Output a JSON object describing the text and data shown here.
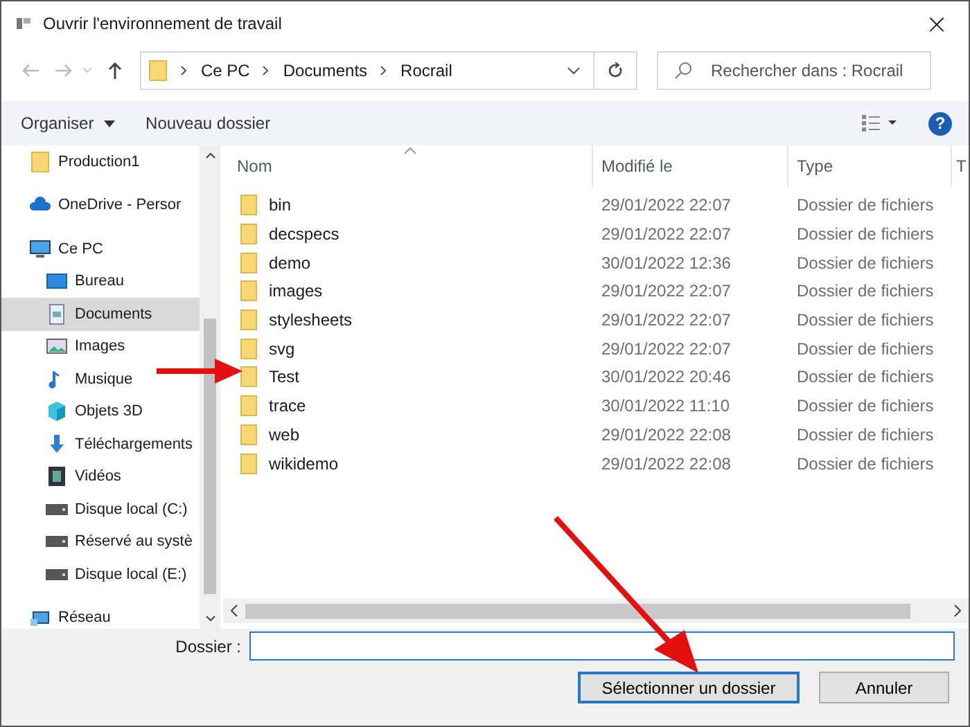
{
  "window": {
    "title": "Ouvrir l'environnement de travail",
    "close": "×"
  },
  "breadcrumb": [
    "Ce PC",
    "Documents",
    "Rocrail"
  ],
  "search": {
    "placeholder": "Rechercher dans : Rocrail"
  },
  "toolbar": {
    "organize": "Organiser",
    "new_folder": "Nouveau dossier",
    "help": "?"
  },
  "sidebar": {
    "items": [
      {
        "label": "Production1",
        "kind": "folder",
        "selected": false
      },
      {
        "label": "OneDrive - Persor",
        "kind": "cloud",
        "selected": false
      },
      {
        "label": "Ce PC",
        "kind": "pc",
        "selected": false,
        "children": [
          {
            "label": "Bureau",
            "kind": "desktop",
            "selected": false
          },
          {
            "label": "Documents",
            "kind": "documents",
            "selected": true
          },
          {
            "label": "Images",
            "kind": "images",
            "selected": false
          },
          {
            "label": "Musique",
            "kind": "music",
            "selected": false
          },
          {
            "label": "Objets 3D",
            "kind": "cube",
            "selected": false
          },
          {
            "label": "Téléchargements",
            "kind": "download",
            "selected": false
          },
          {
            "label": "Vidéos",
            "kind": "video",
            "selected": false
          },
          {
            "label": "Disque local (C:)",
            "kind": "drive",
            "selected": false
          },
          {
            "label": "Réservé au systè",
            "kind": "drive",
            "selected": false
          },
          {
            "label": "Disque local (E:)",
            "kind": "drive",
            "selected": false
          }
        ]
      },
      {
        "label": "Réseau",
        "kind": "network",
        "selected": false
      }
    ]
  },
  "table": {
    "columns": [
      "Nom",
      "Modifié le",
      "Type",
      "T"
    ],
    "rows": [
      {
        "name": "bin",
        "modified": "29/01/2022 22:07",
        "type": "Dossier de fichiers"
      },
      {
        "name": "decspecs",
        "modified": "29/01/2022 22:07",
        "type": "Dossier de fichiers"
      },
      {
        "name": "demo",
        "modified": "30/01/2022 12:36",
        "type": "Dossier de fichiers"
      },
      {
        "name": "images",
        "modified": "29/01/2022 22:07",
        "type": "Dossier de fichiers"
      },
      {
        "name": "stylesheets",
        "modified": "29/01/2022 22:07",
        "type": "Dossier de fichiers"
      },
      {
        "name": "svg",
        "modified": "29/01/2022 22:07",
        "type": "Dossier de fichiers"
      },
      {
        "name": "Test",
        "modified": "30/01/2022 20:46",
        "type": "Dossier de fichiers"
      },
      {
        "name": "trace",
        "modified": "30/01/2022 11:10",
        "type": "Dossier de fichiers"
      },
      {
        "name": "web",
        "modified": "29/01/2022 22:08",
        "type": "Dossier de fichiers"
      },
      {
        "name": "wikidemo",
        "modified": "29/01/2022 22:08",
        "type": "Dossier de fichiers"
      }
    ]
  },
  "folder_field": {
    "label": "Dossier :"
  },
  "buttons": {
    "select": "Sélectionner un dossier",
    "cancel": "Annuler"
  }
}
